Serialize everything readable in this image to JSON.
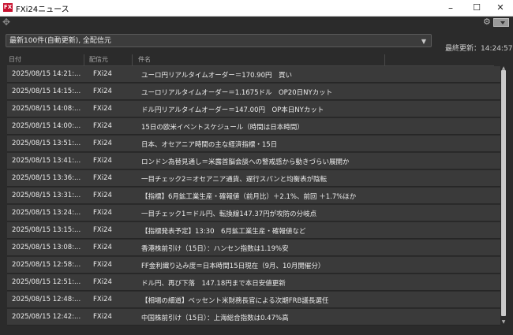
{
  "window": {
    "logo": "FX",
    "title": "FXi24ニュース",
    "minimize": "–",
    "maximize": "☐",
    "close": "✕"
  },
  "toolbar": {
    "move_icon": "✥",
    "settings_icon": "⚙"
  },
  "filter": {
    "selected": "最新100件(自動更新), 全配信元"
  },
  "last_update": "最終更新：14:24:57",
  "columns": {
    "date": "日付",
    "source": "配信元",
    "title": "件名"
  },
  "rows": [
    {
      "date": "2025/08/15 14:21:...",
      "source": "FXi24",
      "title": "ユーロ円リアルタイムオーダー＝170.90円　買い"
    },
    {
      "date": "2025/08/15 14:15:...",
      "source": "FXi24",
      "title": "ユーロリアルタイムオーダー＝1.1675ドル　OP20日NYカット"
    },
    {
      "date": "2025/08/15 14:08:...",
      "source": "FXi24",
      "title": "ドル円リアルタイムオーダー＝147.00円　OP本日NYカット"
    },
    {
      "date": "2025/08/15 14:00:...",
      "source": "FXi24",
      "title": "15日の欧米イベントスケジュール（時間は日本時間）"
    },
    {
      "date": "2025/08/15 13:51:...",
      "source": "FXi24",
      "title": "日本、オセアニア時間の主な経済指標・15日"
    },
    {
      "date": "2025/08/15 13:41:...",
      "source": "FXi24",
      "title": "ロンドン為替見通し＝米露首脳会談への警戒感から動きづらい展開か"
    },
    {
      "date": "2025/08/15 13:36:...",
      "source": "FXi24",
      "title": "一目チェック2＝オセアニア通貨、遅行スパンと均衡表が陰転"
    },
    {
      "date": "2025/08/15 13:31:...",
      "source": "FXi24",
      "title": "【指標】6月鉱工業生産・確報値（前月比）＋2.1%、前回 ＋1.7%ほか"
    },
    {
      "date": "2025/08/15 13:24:...",
      "source": "FXi24",
      "title": "一目チェック1＝ドル円、転換線147.37円が攻防の分岐点"
    },
    {
      "date": "2025/08/15 13:15:...",
      "source": "FXi24",
      "title": "【指標発表予定】13:30　6月鉱工業生産・確報値など"
    },
    {
      "date": "2025/08/15 13:08:...",
      "source": "FXi24",
      "title": "香港株前引け（15日）：ハンセン指数は1.19%安"
    },
    {
      "date": "2025/08/15 12:58:...",
      "source": "FXi24",
      "title": "FF金利織り込み度＝日本時間15日現在（9月、10月開催分）"
    },
    {
      "date": "2025/08/15 12:51:...",
      "source": "FXi24",
      "title": "ドル円、再び下落　147.18円まで本日安値更新"
    },
    {
      "date": "2025/08/15 12:48:...",
      "source": "FXi24",
      "title": "【相場の細道】ベッセント米財務長官による次期FRB議長選任"
    },
    {
      "date": "2025/08/15 12:42:...",
      "source": "FXi24",
      "title": "中国株前引け（15日）：上海総合指数は0.47%高"
    }
  ],
  "scrollbar": {
    "up": "▲",
    "down": "▼"
  }
}
